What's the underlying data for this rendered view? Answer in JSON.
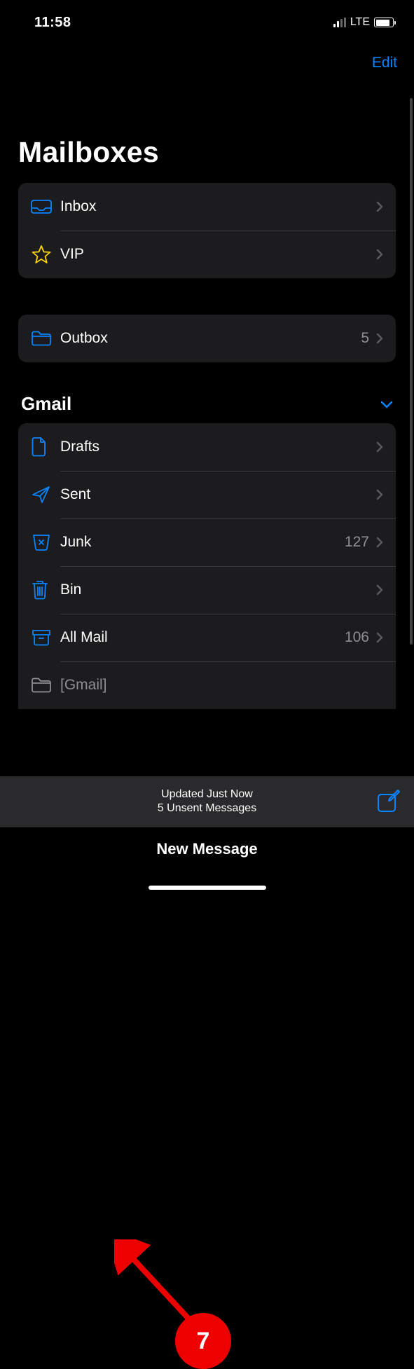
{
  "status": {
    "time": "11:58",
    "network": "LTE"
  },
  "nav": {
    "edit": "Edit"
  },
  "page_title": "Mailboxes",
  "primary": {
    "items": [
      {
        "label": "Inbox",
        "count": ""
      },
      {
        "label": "VIP",
        "count": ""
      }
    ]
  },
  "outbox": {
    "label": "Outbox",
    "count": "5"
  },
  "account": {
    "name": "Gmail",
    "items": [
      {
        "label": "Drafts",
        "count": ""
      },
      {
        "label": "Sent",
        "count": ""
      },
      {
        "label": "Junk",
        "count": "127"
      },
      {
        "label": "Bin",
        "count": ""
      },
      {
        "label": "All Mail",
        "count": "106"
      },
      {
        "label": "[Gmail]",
        "count": ""
      }
    ]
  },
  "toolbar": {
    "status_line1": "Updated Just Now",
    "status_line2": "5 Unsent Messages"
  },
  "new_message": "New Message",
  "annotation": {
    "number": "7"
  }
}
